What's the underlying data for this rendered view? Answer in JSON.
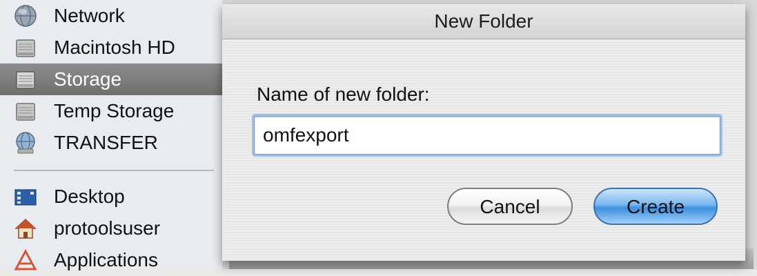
{
  "sidebar": {
    "items": [
      {
        "label": "Network",
        "icon": "network-globe-icon"
      },
      {
        "label": "Macintosh HD",
        "icon": "hard-drive-icon"
      },
      {
        "label": "Storage",
        "icon": "hard-drive-icon",
        "selected": true
      },
      {
        "label": "Temp Storage",
        "icon": "hard-drive-icon"
      },
      {
        "label": "TRANSFER",
        "icon": "network-volume-icon"
      },
      {
        "label": "Desktop",
        "icon": "desktop-icon"
      },
      {
        "label": "protoolsuser",
        "icon": "home-icon"
      },
      {
        "label": "Applications",
        "icon": "applications-icon"
      }
    ]
  },
  "dialog": {
    "title": "New Folder",
    "prompt": "Name of new folder:",
    "name_value": "omfexport",
    "cancel_label": "Cancel",
    "create_label": "Create"
  },
  "colors": {
    "selection": "#7a7a7a",
    "default_button": "#5aa2ea",
    "focus_ring": "#9fc0e6"
  }
}
